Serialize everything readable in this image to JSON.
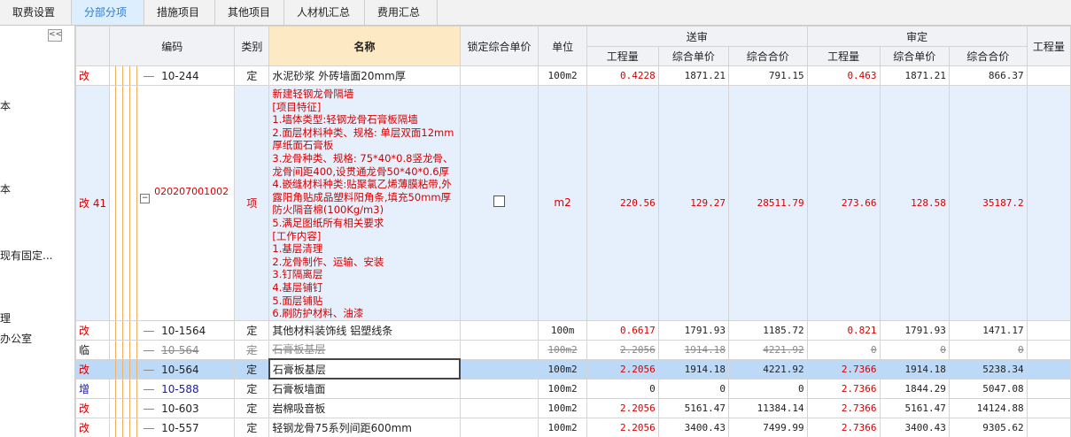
{
  "tabs": [
    "取费设置",
    "分部分项",
    "措施项目",
    "其他项目",
    "人材机汇总",
    "费用汇总"
  ],
  "active_tab": 1,
  "left_panel": {
    "collapse_label": "<<",
    "items": [
      "本",
      "本",
      "现有固定...",
      "理",
      "办公室"
    ]
  },
  "headers": {
    "code": "编码",
    "type": "类别",
    "name": "名称",
    "lock_price": "锁定综合单价",
    "unit": "单位",
    "submitted": "送审",
    "approved": "审定",
    "quantity": "工程量",
    "unit_price": "综合单价",
    "total_price": "综合合价"
  },
  "rows": [
    {
      "flag": "改",
      "code": "10-244",
      "type": "定",
      "name": "水泥砂浆 外砖墙面20mm厚",
      "unit": "100m2",
      "s_qty": "0.4228",
      "s_price": "1871.21",
      "s_total": "791.15",
      "a_qty": "0.463",
      "a_price": "1871.21",
      "a_total": "866.37"
    },
    {
      "flag": "改 41",
      "code": "020207001002",
      "type": "项",
      "name_lines": [
        "新建轻钢龙骨隔墙",
        "[项目特征]",
        "1.墙体类型:轻钢龙骨石膏板隔墙",
        "2.面层材料种类、规格: 单层双面12mm厚纸面石膏板",
        "3.龙骨种类、规格: 75*40*0.8竖龙骨、龙骨间距400,设贯通龙骨50*40*0.6厚",
        "4.嵌缝材料种类:贴聚氯乙烯薄膜粘带,外露阳角贴成品塑料阳角条,填充50mm厚防火隔音棉(100Kg/m3)",
        "5.满足图纸所有相关要求",
        "[工作内容]",
        "1.基层清理",
        "2.龙骨制作、运输、安装",
        "3.钉隔离层",
        "4.基层铺钉",
        "5.面层铺贴",
        "6.刷防护材料、油漆"
      ],
      "unit": "m2",
      "s_qty": "220.56",
      "s_price": "129.27",
      "s_total": "28511.79",
      "a_qty": "273.66",
      "a_price": "128.58",
      "a_total": "35187.2"
    },
    {
      "flag": "改",
      "code": "10-1564",
      "type": "定",
      "name": "其他材料装饰线 铝塑线条",
      "unit": "100m",
      "s_qty": "0.6617",
      "s_price": "1791.93",
      "s_total": "1185.72",
      "a_qty": "0.821",
      "a_price": "1791.93",
      "a_total": "1471.17"
    },
    {
      "flag": "临",
      "code": "10-564",
      "type": "定",
      "name": "石膏板基层",
      "unit": "100m2",
      "s_qty": "2.2056",
      "s_price": "1914.18",
      "s_total": "4221.92",
      "a_qty": "0",
      "a_price": "0",
      "a_total": "0"
    },
    {
      "flag": "改",
      "code": "10-564",
      "type": "定",
      "name": "石膏板基层",
      "unit": "100m2",
      "s_qty": "2.2056",
      "s_price": "1914.18",
      "s_total": "4221.92",
      "a_qty": "2.7366",
      "a_price": "1914.18",
      "a_total": "5238.34"
    },
    {
      "flag": "增",
      "code": "10-588",
      "type": "定",
      "name": "石膏板墙面",
      "unit": "100m2",
      "s_qty": "0",
      "s_price": "0",
      "s_total": "0",
      "a_qty": "2.7366",
      "a_price": "1844.29",
      "a_total": "5047.08"
    },
    {
      "flag": "改",
      "code": "10-603",
      "type": "定",
      "name": "岩棉吸音板",
      "unit": "100m2",
      "s_qty": "2.2056",
      "s_price": "5161.47",
      "s_total": "11384.14",
      "a_qty": "2.7366",
      "a_price": "5161.47",
      "a_total": "14124.88"
    },
    {
      "flag": "改",
      "code": "10-557",
      "type": "定",
      "name": "轻钢龙骨75系列间距600mm",
      "unit": "100m2",
      "s_qty": "2.2056",
      "s_price": "3400.43",
      "s_total": "7499.99",
      "a_qty": "2.7366",
      "a_price": "3400.43",
      "a_total": "9305.62"
    }
  ]
}
